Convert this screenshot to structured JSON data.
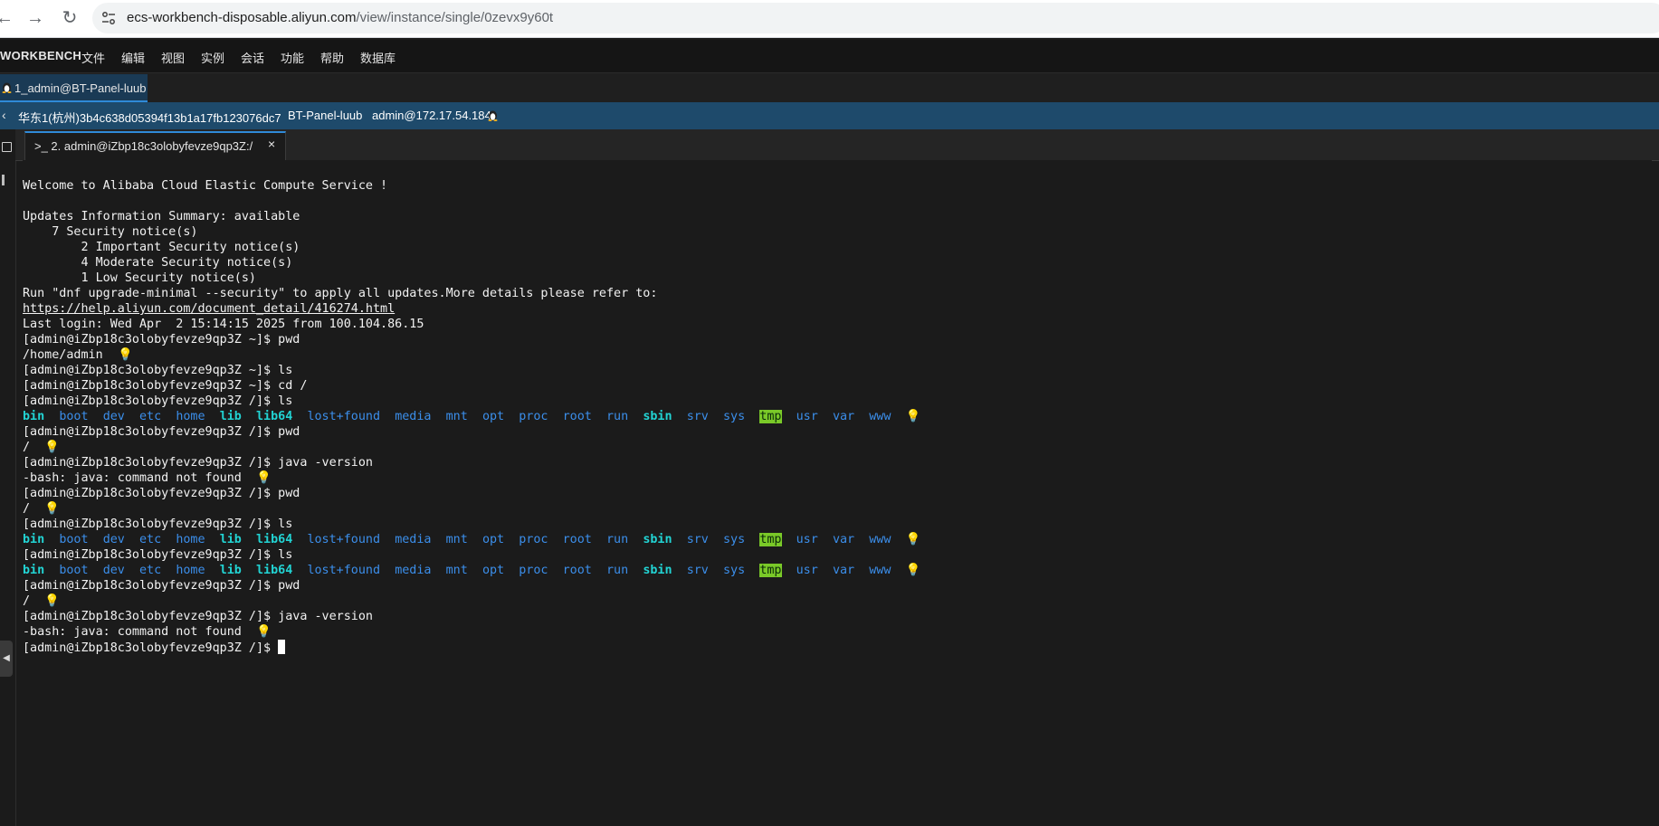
{
  "browser": {
    "url_host": "ecs-workbench-disposable.aliyun.com",
    "url_path": "/view/instance/single/0zevx9y60t"
  },
  "app": {
    "brand": "WORKBENCH",
    "menu": [
      "文件",
      "编辑",
      "视图",
      "实例",
      "会话",
      "功能",
      "帮助",
      "数据库"
    ]
  },
  "session_tab": {
    "label": "1_admin@BT-Panel-luub"
  },
  "instance_bar": {
    "region_id": "华东1(杭州)3b4c638d05394f13b1a17fb123076dc7",
    "name": "BT-Panel-luub",
    "login": "admin@172.17.54.184"
  },
  "terminal_tab": {
    "label": ">_ 2. admin@iZbp18c3olobyfevze9qp3Z:/",
    "close": "×"
  },
  "terminal": {
    "welcome": "Welcome to Alibaba Cloud Elastic Compute Service !",
    "updates_summary": "Updates Information Summary: available",
    "security_total": "    7 Security notice(s)",
    "security_important": "        2 Important Security notice(s)",
    "security_moderate": "        4 Moderate Security notice(s)",
    "security_low": "        1 Low Security notice(s)",
    "upgrade_hint": "Run \"dnf upgrade-minimal --security\" to apply all updates.More details please refer to:",
    "help_link": "https://help.aliyun.com/document_detail/416274.html",
    "last_login": "Last login: Wed Apr  2 15:14:15 2025 from 100.104.86.15",
    "cmd_pwd_home": "[admin@iZbp18c3olobyfevze9qp3Z ~]$ pwd",
    "out_home": "/home/admin",
    "cmd_ls_home": "[admin@iZbp18c3olobyfevze9qp3Z ~]$ ls",
    "cmd_cd": "[admin@iZbp18c3olobyfevze9qp3Z ~]$ cd /",
    "cmd_ls_root": "[admin@iZbp18c3olobyfevze9qp3Z /]$ ls",
    "cmd_pwd_root": "[admin@iZbp18c3olobyfevze9qp3Z /]$ pwd",
    "out_root": "/",
    "cmd_java": "[admin@iZbp18c3olobyfevze9qp3Z /]$ java -version",
    "out_java_error": "-bash: java: command not found",
    "prompt": "[admin@iZbp18c3olobyfevze9qp3Z /]$ ",
    "ls_dirs": [
      "bin",
      "boot",
      "dev",
      "etc",
      "home",
      "lib",
      "lib64",
      "lost+found",
      "media",
      "mnt",
      "opt",
      "proc",
      "root",
      "run",
      "sbin",
      "srv",
      "sys",
      "tmp",
      "usr",
      "var",
      "www"
    ]
  },
  "colors": {
    "terminal_bg": "#1b1b1b",
    "dir_blue": "#3b8eea",
    "symlink_cyan": "#22d4d4",
    "tmp_highlight": "#7ac928",
    "tab_accent": "#2f8ad8",
    "info_bar": "#1e4a6b"
  },
  "icons": [
    "back-arrow-icon",
    "forward-arrow-icon",
    "reload-icon",
    "site-settings-icon",
    "linux-tux-icon",
    "chevron-left-icon",
    "terminal-icon",
    "close-icon",
    "lightbulb-icon",
    "collapse-arrow-icon"
  ]
}
